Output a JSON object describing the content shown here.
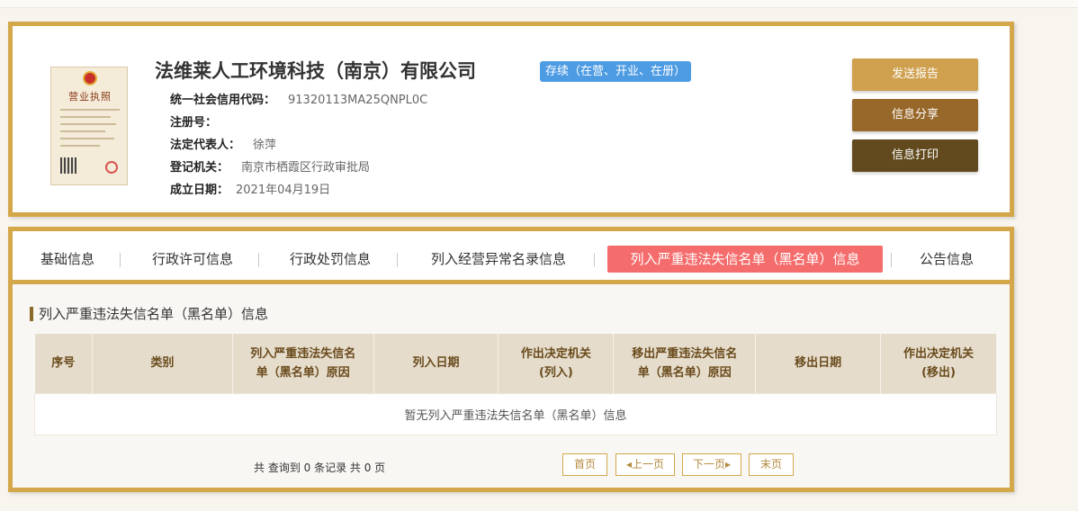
{
  "company": {
    "name": "法维莱人工环境科技（南京）有限公司",
    "status": "存续（在营、开业、在册）",
    "license_title": "营业执照",
    "fields": [
      {
        "label": "统一社会信用代码：",
        "value": "91320113MA25QNPL0C"
      },
      {
        "label": "注册号：",
        "value": ""
      },
      {
        "label": "法定代表人：",
        "value": "徐萍"
      },
      {
        "label": "登记机关：",
        "value": "南京市栖霞区行政审批局"
      },
      {
        "label": "成立日期：",
        "value": "2021年04月19日"
      }
    ]
  },
  "actions": {
    "send_report": "发送报告",
    "share": "信息分享",
    "print": "信息打印"
  },
  "tabs": [
    "基础信息",
    "行政许可信息",
    "行政处罚信息",
    "列入经营异常名录信息",
    "列入严重违法失信名单（黑名单）信息",
    "公告信息"
  ],
  "active_tab": "列入严重违法失信名单（黑名单）信息",
  "section": {
    "title": "列入严重违法失信名单（黑名单）信息",
    "columns": [
      [
        "序号"
      ],
      [
        "类别"
      ],
      [
        "列入严重违法失信名",
        "单（黑名单）原因"
      ],
      [
        "列入日期"
      ],
      [
        "作出决定机关",
        "(列入)"
      ],
      [
        "移出严重违法失信名",
        "单（黑名单）原因"
      ],
      [
        "移出日期"
      ],
      [
        "作出决定机关",
        "(移出)"
      ]
    ],
    "empty_message": "暂无列入严重违法失信名单（黑名单）信息"
  },
  "pagination": {
    "summary": "共 查询到 0 条记录 共 0 页",
    "first": "首页",
    "prev": "上一页",
    "next": "下一页",
    "last": "末页"
  },
  "colors": {
    "border": "#d3a74a",
    "status": "#4d9be3",
    "active_tab": "#f56c6c",
    "btn_report": "#cfa04e",
    "btn_share": "#98672a",
    "btn_print": "#624a1e",
    "table_header": "#e5dccc"
  }
}
